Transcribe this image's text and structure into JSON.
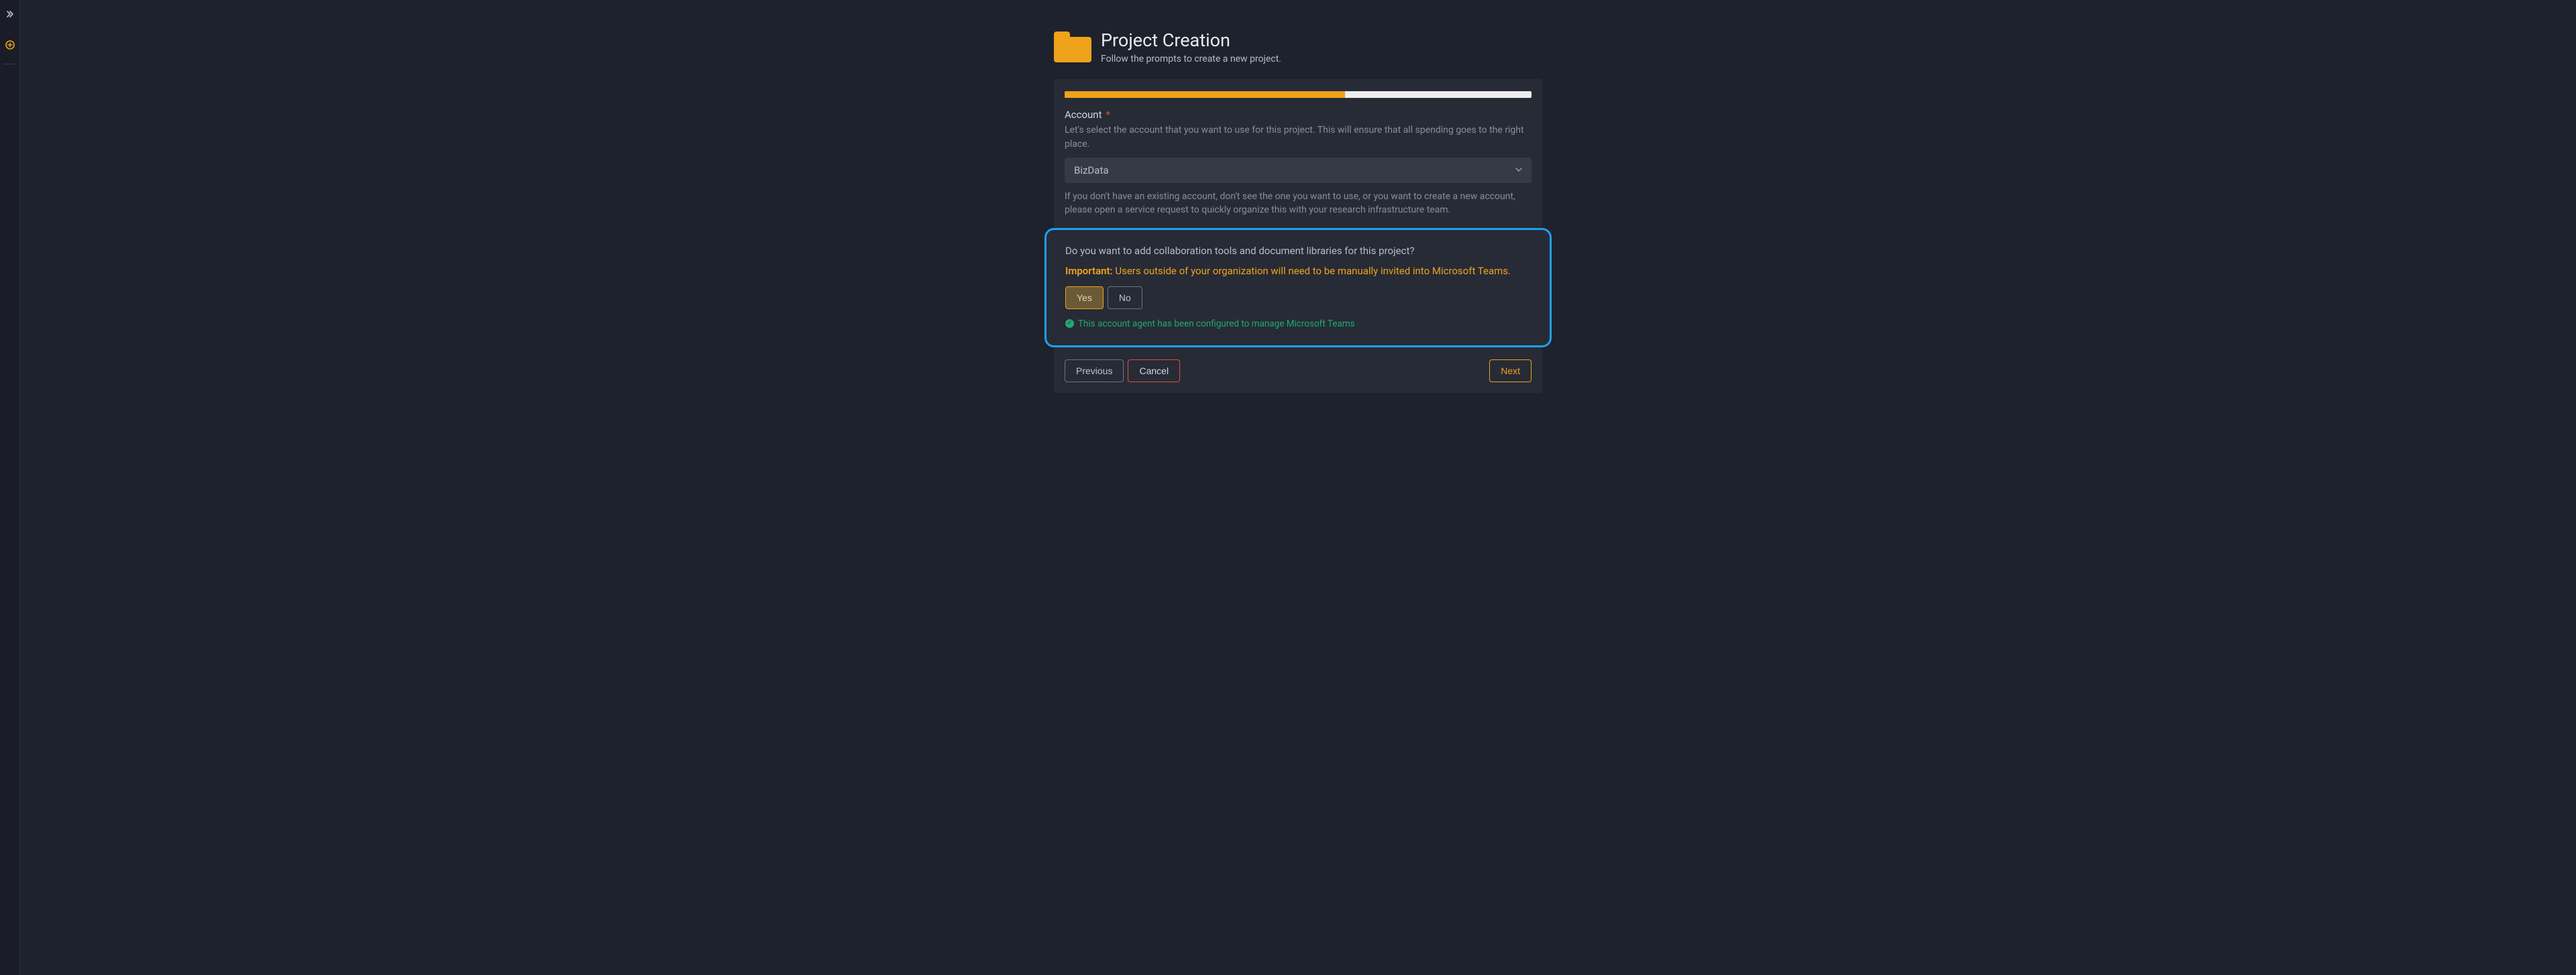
{
  "header": {
    "title": "Project Creation",
    "subtitle": "Follow the prompts to create a new project."
  },
  "progress": {
    "percent": 60
  },
  "account": {
    "label": "Account",
    "required_marker": "*",
    "help1": "Let's select the account that you want to use for this project. This will ensure that all spending goes to the right place.",
    "selected": "BizData",
    "help2": "If you don't have an existing account, don't see the one you want to use, or you want to create a new account, please open a service request to quickly organize this with your research infrastructure team."
  },
  "collab": {
    "question": "Do you want to add collaboration tools and document libraries for this project?",
    "important_label": "Important:",
    "important_text": " Users outside of your organization will need to be manually invited into Microsoft Teams.",
    "yes": "Yes",
    "no": "No",
    "status": "This account agent has been configured to manage Microsoft Teams"
  },
  "buttons": {
    "previous": "Previous",
    "cancel": "Cancel",
    "next": "Next"
  },
  "colors": {
    "accent": "#efa21a",
    "callout_border": "#1da1f2",
    "success": "#22a772",
    "danger": "#e74c3c"
  }
}
